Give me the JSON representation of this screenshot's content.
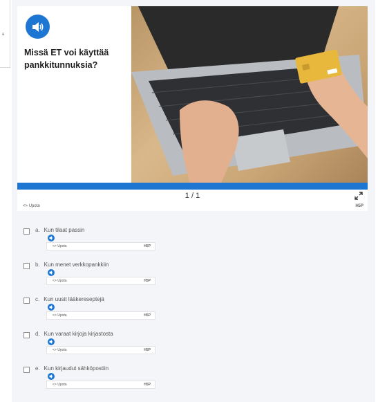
{
  "left_frame": {
    "fragment": "a"
  },
  "slide": {
    "question": "Missä ET voi käyttää pankkitunnuksia?",
    "counter": "1 / 1",
    "progress": 1.0,
    "accent_color": "#1c76d2"
  },
  "utility": {
    "embed": "Upota",
    "h5p": "H5P"
  },
  "options": [
    {
      "letter": "a.",
      "text": "Kun tilaat passin"
    },
    {
      "letter": "b.",
      "text": "Kun menet verkkopankkiin"
    },
    {
      "letter": "c.",
      "text": "Kun uusit lääkereseptejä"
    },
    {
      "letter": "d.",
      "text": "Kun varaat kirjoja kirjastosta"
    },
    {
      "letter": "e.",
      "text": "Kun kirjaudut sähköpostiin"
    }
  ]
}
